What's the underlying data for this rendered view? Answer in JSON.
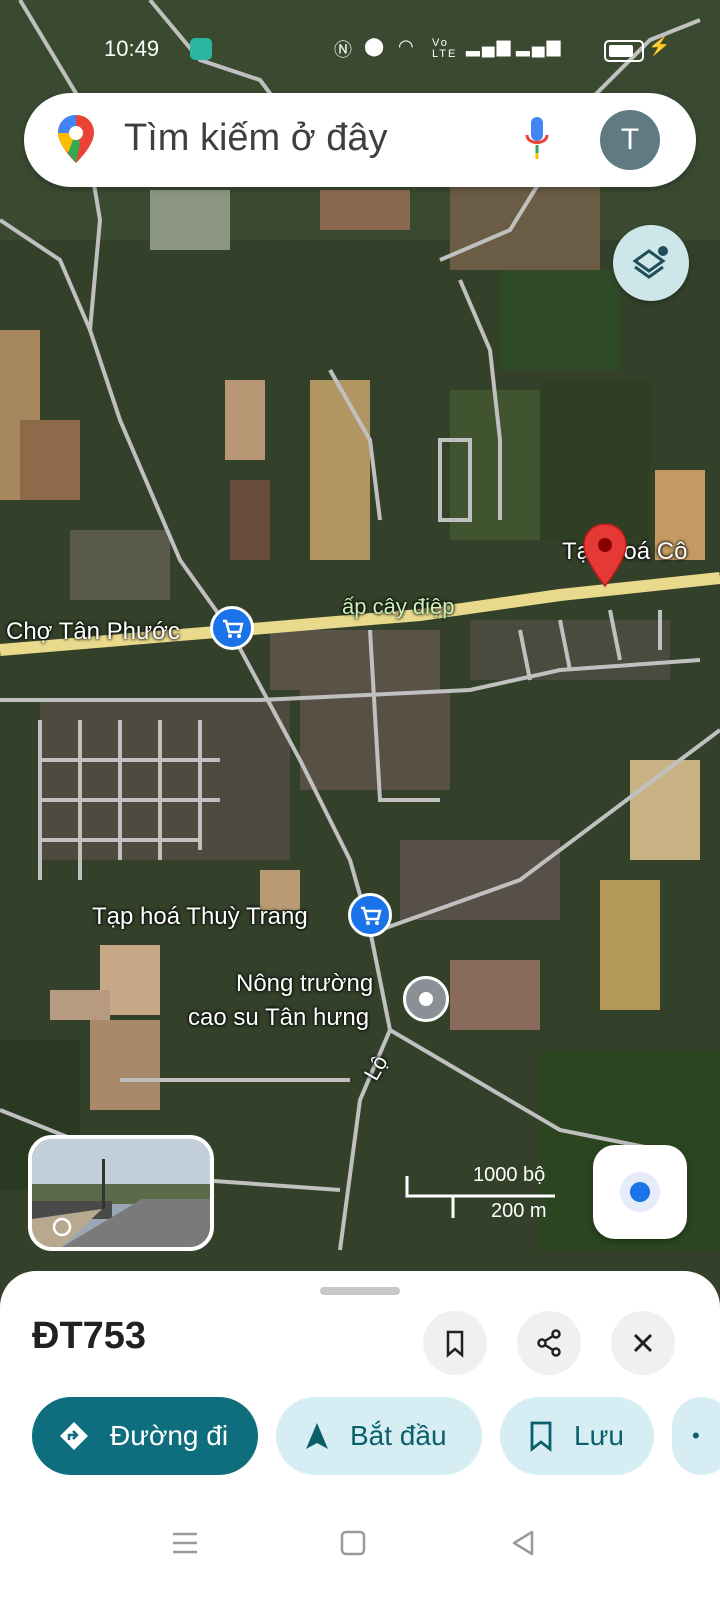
{
  "status_bar": {
    "time": "10:49",
    "icons": [
      "nfc-icon",
      "location-icon",
      "wifi-icon",
      "volte-icon",
      "signal-icon",
      "signal-icon",
      "battery-icon",
      "charging-icon"
    ],
    "volte_text": "Vo LTE",
    "battery_level": 0.85
  },
  "search": {
    "placeholder": "Tìm kiếm ở đây",
    "account_initial": "T"
  },
  "map": {
    "labels": {
      "market": "Chợ Tân Phước",
      "road_name": "ấp cây điệp",
      "shop_pin": "Tạp hoá Cô",
      "shop": "Tạp hoá Thuỳ Trang",
      "farm_line1": "Nông trường",
      "farm_line2": "cao su Tân hưng",
      "side_road": "Lộ"
    },
    "colors": {
      "main_road": "#e9d98c",
      "side_road": "#bcbcbc",
      "pin_red": "#e53935",
      "poi_blue": "#1a73e8"
    }
  },
  "scale": {
    "feet": "1000 bộ",
    "meters": "200 m"
  },
  "sheet": {
    "title": "ĐT753",
    "buttons": {
      "directions": "Đường đi",
      "start": "Bắt đầu",
      "save": "Lưu"
    },
    "colors": {
      "primary": "#0f6e7d",
      "secondary": "#d6eef3"
    }
  }
}
